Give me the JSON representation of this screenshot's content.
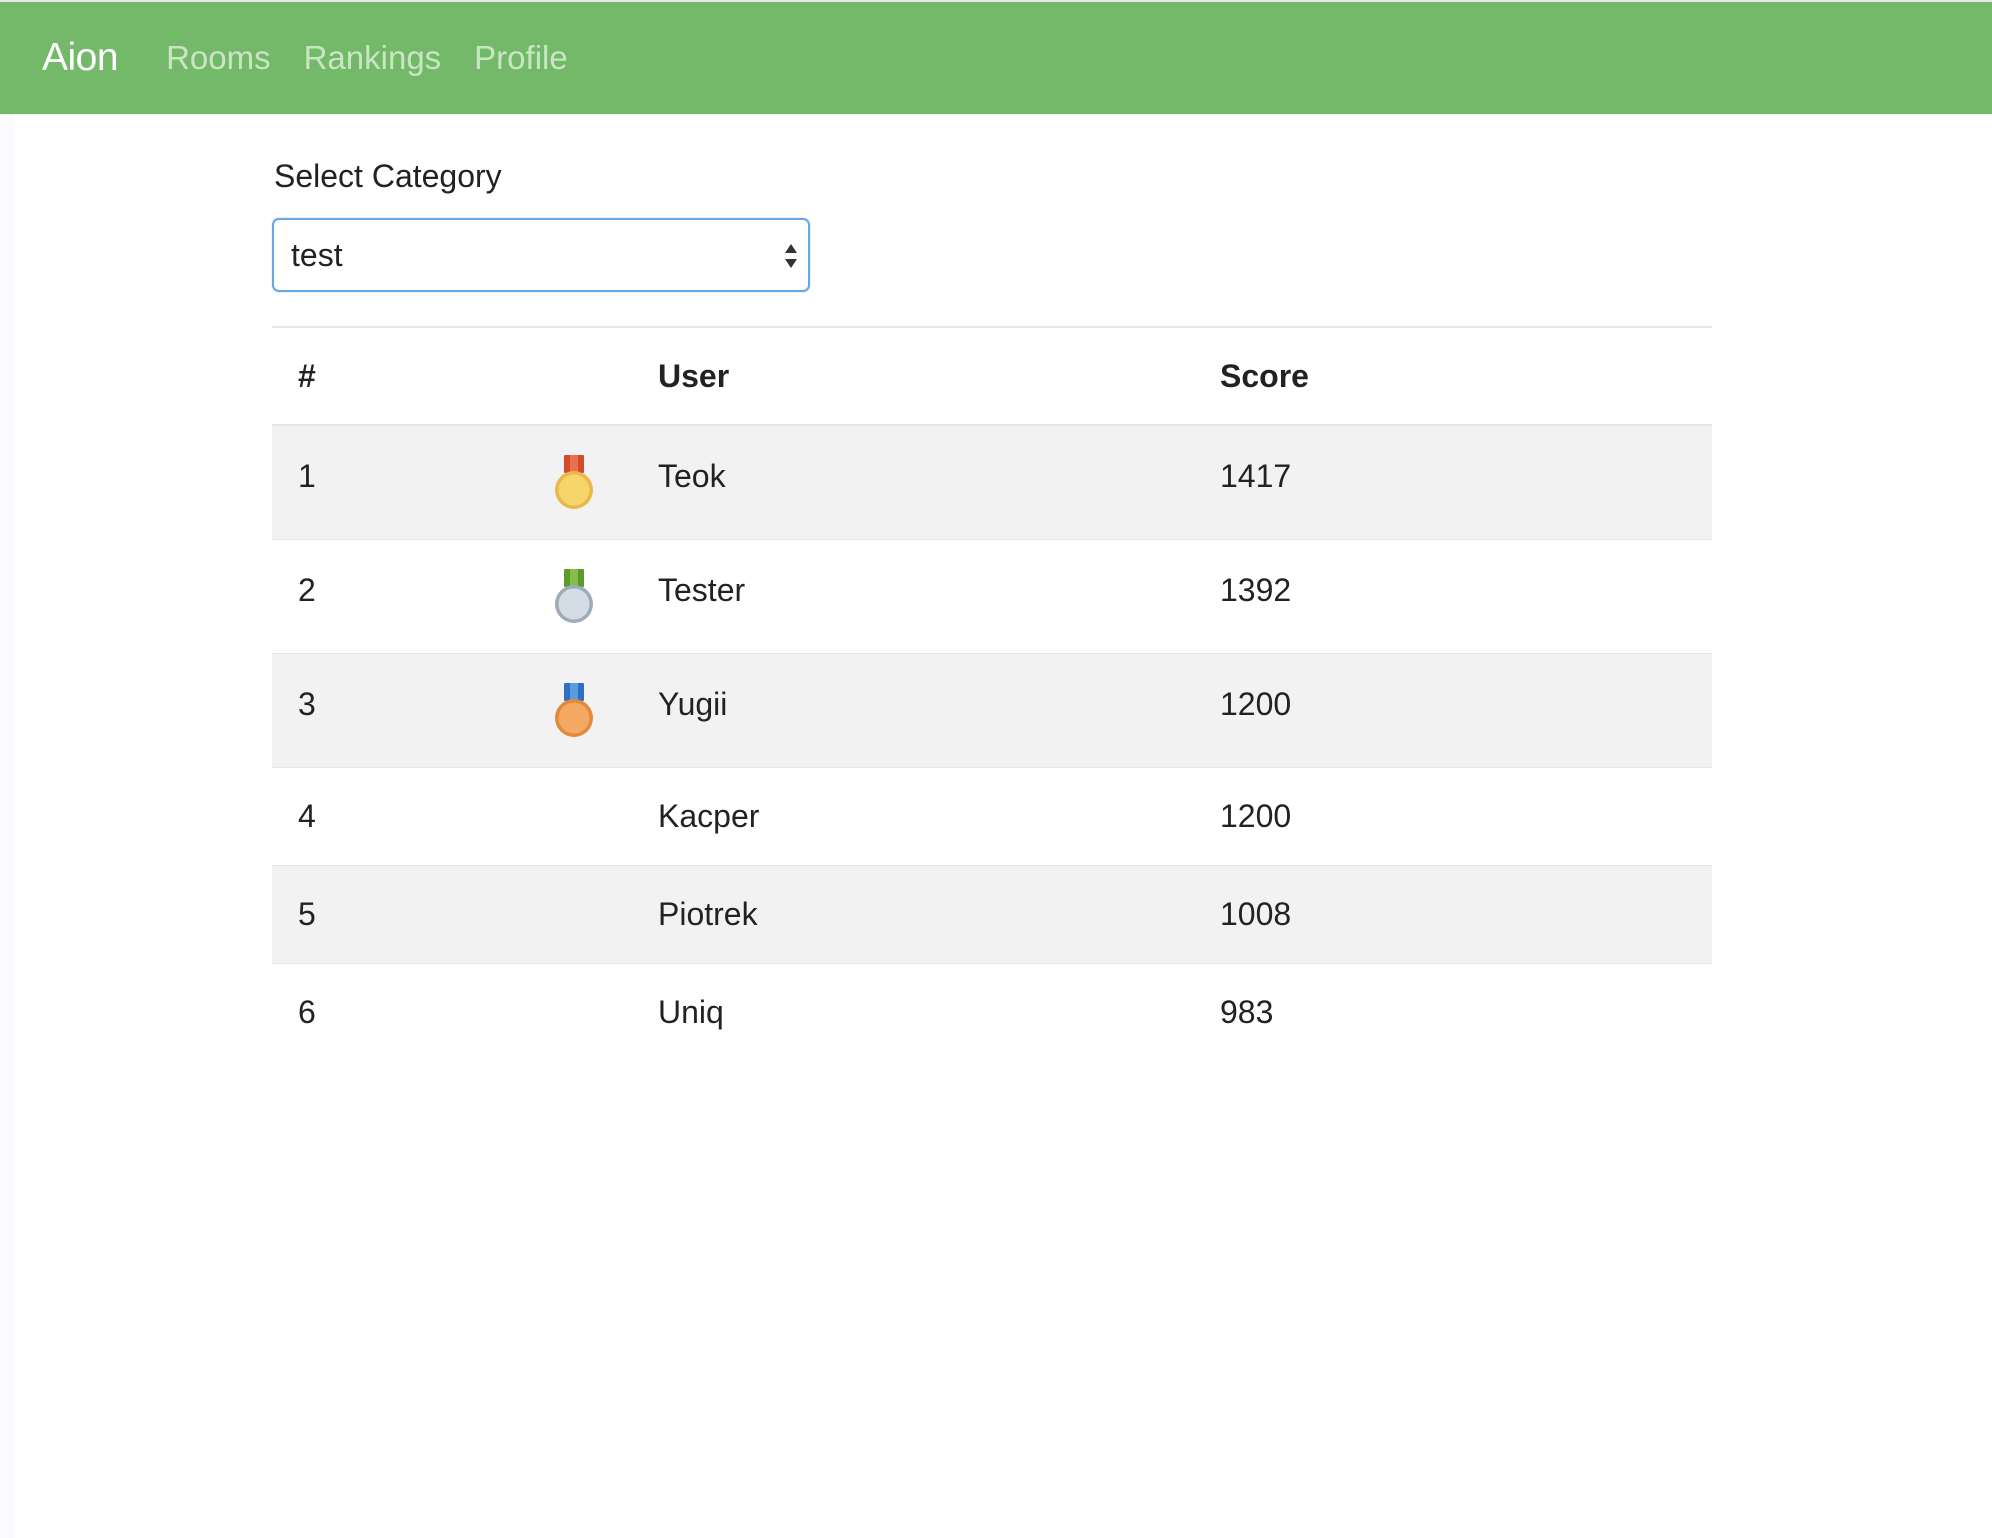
{
  "navbar": {
    "brand": "Aion",
    "links": [
      {
        "label": "Rooms"
      },
      {
        "label": "Rankings"
      },
      {
        "label": "Profile"
      }
    ]
  },
  "category": {
    "label": "Select Category",
    "selected": "test"
  },
  "table": {
    "headers": {
      "rank": "#",
      "user": "User",
      "score": "Score"
    },
    "rows": [
      {
        "rank": "1",
        "user": "Teok",
        "score": "1417",
        "medal": "gold-medal-icon"
      },
      {
        "rank": "2",
        "user": "Tester",
        "score": "1392",
        "medal": "silver-medal-icon"
      },
      {
        "rank": "3",
        "user": "Yugii",
        "score": "1200",
        "medal": "bronze-medal-icon"
      },
      {
        "rank": "4",
        "user": "Kacper",
        "score": "1200"
      },
      {
        "rank": "5",
        "user": "Piotrek",
        "score": "1008"
      },
      {
        "rank": "6",
        "user": "Uniq",
        "score": "983"
      }
    ]
  },
  "colors": {
    "navbar": "#74b86a",
    "select_border": "#66a7e6",
    "striped_row": "#f2f2f2"
  }
}
